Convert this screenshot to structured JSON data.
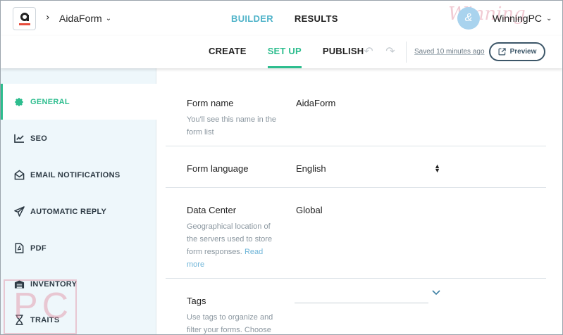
{
  "header": {
    "form_title": "AidaForm",
    "tabs": [
      {
        "label": "BUILDER",
        "active": true
      },
      {
        "label": "RESULTS",
        "active": false
      }
    ],
    "user_name": "WinningPC",
    "accent_color": "#4fb3c9"
  },
  "subnav": {
    "tabs": [
      {
        "label": "CREATE",
        "active": false
      },
      {
        "label": "SET UP",
        "active": true
      },
      {
        "label": "PUBLISH",
        "active": false
      }
    ],
    "saved_text": "Saved 10 minutes ago",
    "preview_label": "Preview",
    "active_color": "#2dbd8e"
  },
  "sidebar": {
    "items": [
      {
        "label": "GENERAL",
        "icon": "gear-icon",
        "active": true
      },
      {
        "label": "SEO",
        "icon": "trend-chart-icon",
        "active": false
      },
      {
        "label": "EMAIL NOTIFICATIONS",
        "icon": "envelope-icon",
        "active": false
      },
      {
        "label": "AUTOMATIC REPLY",
        "icon": "paper-plane-icon",
        "active": false
      },
      {
        "label": "PDF",
        "icon": "pdf-document-icon",
        "active": false
      },
      {
        "label": "INVENTORY",
        "icon": "inventory-icon",
        "active": false
      },
      {
        "label": "TRAITS",
        "icon": "hourglass-icon",
        "active": false
      }
    ]
  },
  "settings": {
    "form_name": {
      "label": "Form name",
      "description": "You'll see this name in the form list",
      "value": "AidaForm"
    },
    "form_language": {
      "label": "Form language",
      "value": "English"
    },
    "data_center": {
      "label": "Data Center",
      "description": "Geographical location of the servers used to store form responses.",
      "link_text": "Read more",
      "value": "Global"
    },
    "tags": {
      "label": "Tags",
      "description": "Use tags to organize and filter your forms. Choose"
    }
  },
  "watermark": {
    "top": "Winning",
    "bottom": "PC"
  }
}
